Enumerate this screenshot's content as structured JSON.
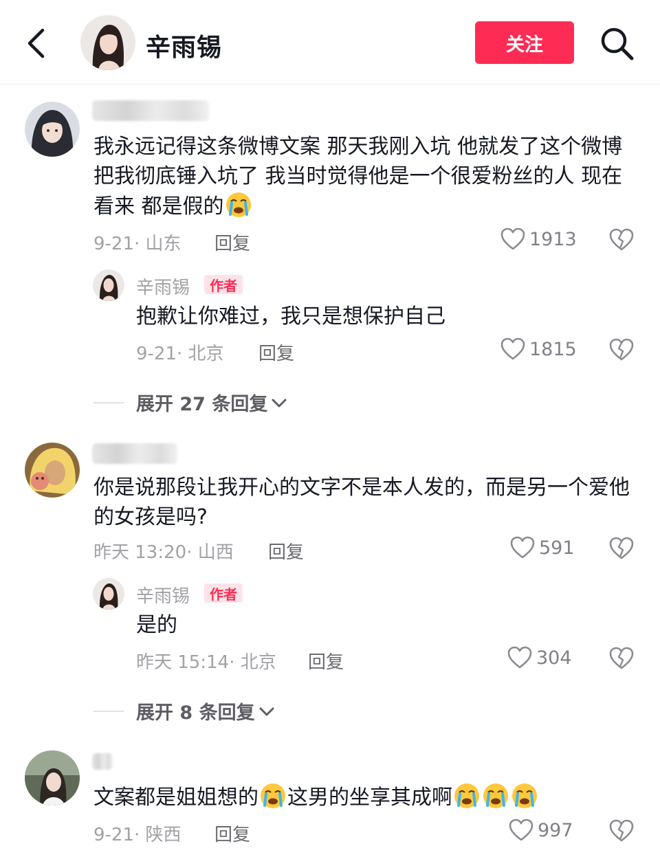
{
  "header": {
    "back_icon": "chevron-left-icon",
    "name": "辛雨锡",
    "follow_label": "关注",
    "search_icon": "search-icon",
    "accent_color": "#fe2c55"
  },
  "comments": [
    {
      "text": "我永远记得这条微博文案 那天我刚入坑 他就发了这个微博 把我彻底锤入坑了 我当时觉得他是一个很爱粉丝的人 现在看来 都是假的",
      "emoji": "loudly-crying-face",
      "date_location": "9-21· 山东",
      "reply_label": "回复",
      "likes": "1913",
      "author_reply": {
        "name": "辛雨锡",
        "badge": "作者",
        "text": "抱歉让你难过，我只是想保护自己",
        "date_location": "9-21· 北京",
        "reply_label": "回复",
        "likes": "1815"
      },
      "expand_label": "展开 27 条回复"
    },
    {
      "text": "你是说那段让我开心的文字不是本人发的，而是另一个爱他的女孩是吗?",
      "date_location": "昨天 13:20· 山西",
      "reply_label": "回复",
      "likes": "591",
      "author_reply": {
        "name": "辛雨锡",
        "badge": "作者",
        "text": "是的",
        "date_location": "昨天 15:14· 北京",
        "reply_label": "回复",
        "likes": "304"
      },
      "expand_label": "展开 8 条回复"
    },
    {
      "text_a": "文案都是姐姐想的",
      "text_b": "这男的坐享其成啊",
      "date_location": "9-21· 陕西",
      "reply_label": "回复",
      "likes": "997"
    }
  ]
}
